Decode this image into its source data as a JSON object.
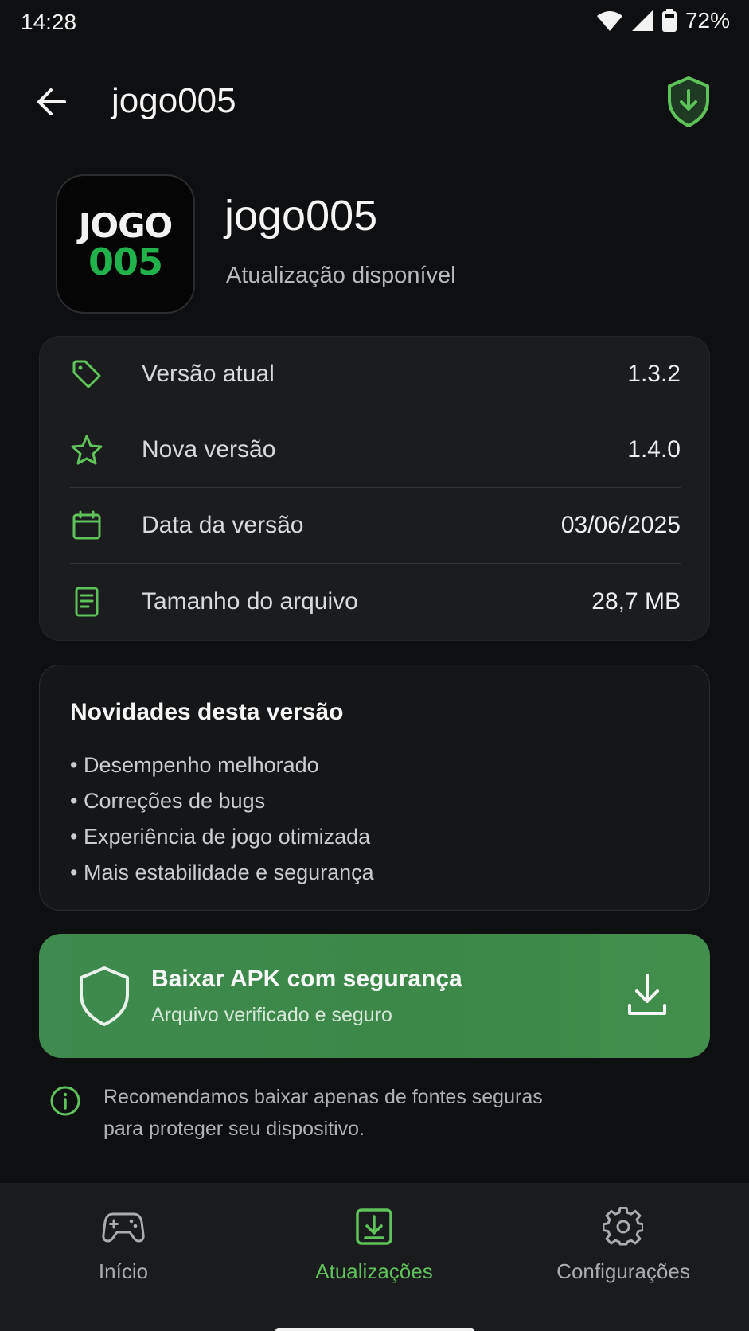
{
  "status_bar": {
    "time": "14:28",
    "battery_pct": "72%"
  },
  "app_bar": {
    "title": "jogo005"
  },
  "app": {
    "icon_line1": "JOGO",
    "icon_line2": "005",
    "name": "jogo005",
    "subtitle": "Atualização disponível"
  },
  "info": {
    "rows": [
      {
        "icon": "tag-icon",
        "label": "Versão atual",
        "value": "1.3.2"
      },
      {
        "icon": "star-icon",
        "label": "Nova versão",
        "value": "1.4.0"
      },
      {
        "icon": "calendar-icon",
        "label": "Data da versão",
        "value": "03/06/2025"
      },
      {
        "icon": "document-icon",
        "label": "Tamanho do arquivo",
        "value": "28,7 MB"
      }
    ]
  },
  "news": {
    "title": "Novidades desta versão",
    "items": [
      "Desempenho melhorado",
      "Correções de bugs",
      "Experiência de jogo otimizada",
      "Mais estabilidade e segurança"
    ]
  },
  "download": {
    "title": "Baixar APK com segurança",
    "subtitle": "Arquivo verificado e seguro"
  },
  "notice": {
    "line1": "Recomendamos baixar apenas de fontes seguras",
    "line2": "para proteger seu dispositivo."
  },
  "nav": {
    "items": [
      {
        "icon": "gamepad-icon",
        "label": "Início"
      },
      {
        "icon": "download-box-icon",
        "label": "Atualizações"
      },
      {
        "icon": "gear-icon",
        "label": "Configurações"
      }
    ],
    "active_index": 1
  },
  "colors": {
    "accent": "#5fc25a",
    "button_green": "#3f8a4e",
    "background": "#0e0f10",
    "card": "#1b1c1e"
  }
}
